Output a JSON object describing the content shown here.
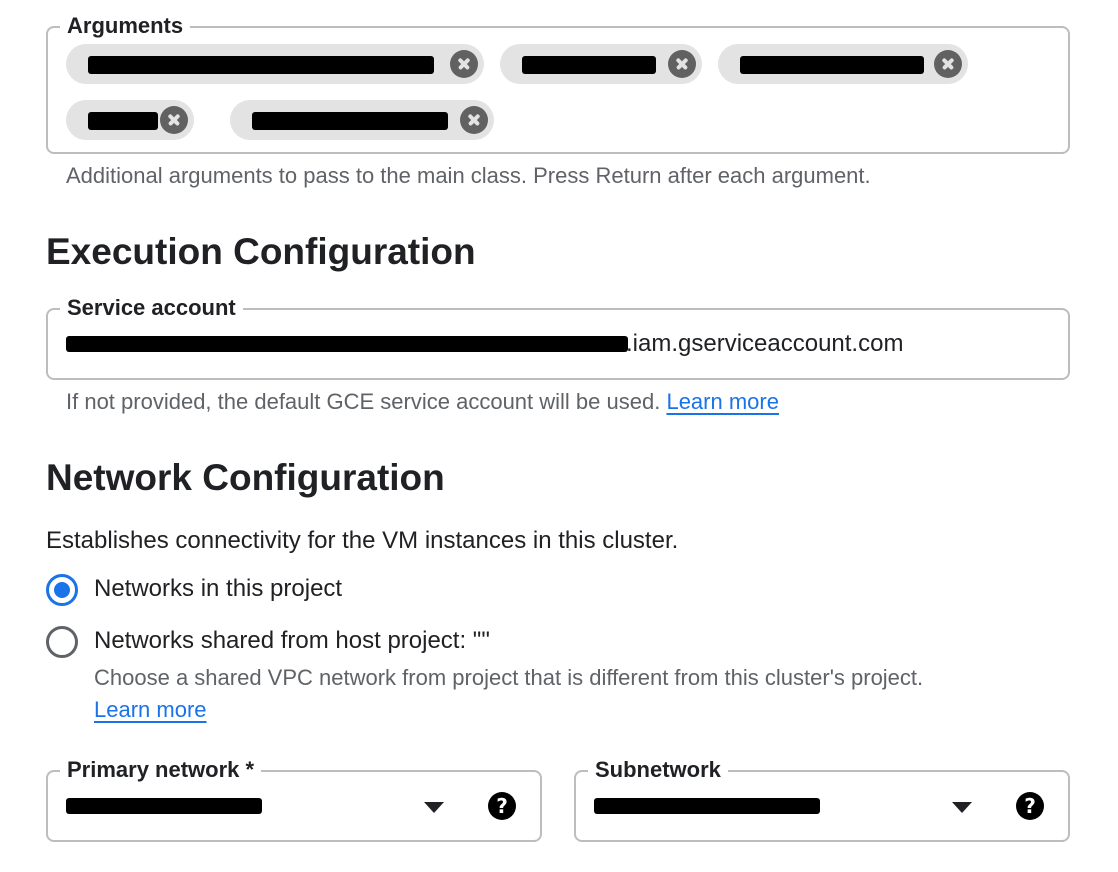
{
  "arguments": {
    "label": "Arguments",
    "chips": [
      {
        "value": "[redacted]"
      },
      {
        "value": "[redacted]"
      },
      {
        "value": "[redacted]"
      },
      {
        "value": "[redacted]"
      },
      {
        "value": "[redacted]"
      }
    ],
    "helper": "Additional arguments to pass to the main class. Press Return after each argument."
  },
  "execution": {
    "title": "Execution Configuration",
    "service_account": {
      "label": "Service account",
      "value_suffix": ".iam.gserviceaccount.com",
      "helper": "If not provided, the default GCE service account will be used.",
      "learn_more": "Learn more"
    }
  },
  "network": {
    "title": "Network Configuration",
    "description": "Establishes connectivity for the VM instances in this cluster.",
    "options": [
      {
        "label": "Networks in this project",
        "selected": true
      },
      {
        "label": "Networks shared from host project: \"\"",
        "selected": false,
        "sublabel": "Choose a shared VPC network from project that is different from this cluster's project.",
        "learn_more": "Learn more"
      }
    ],
    "primary_network": {
      "label": "Primary network *",
      "help_icon": "?"
    },
    "subnetwork": {
      "label": "Subnetwork",
      "help_icon": "?"
    }
  },
  "colors": {
    "accent": "#1a73e8",
    "chip_bg": "#e3e3e3",
    "border": "#bdbdbd"
  }
}
